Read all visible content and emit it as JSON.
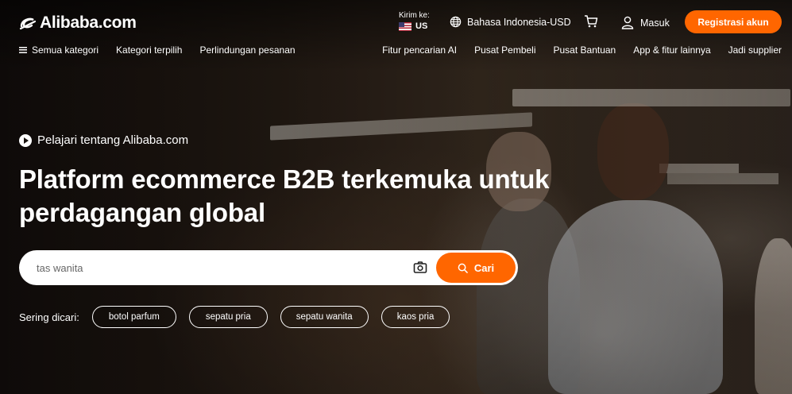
{
  "header": {
    "logo_text": "Alibaba.com",
    "ship_to_label": "Kirim ke:",
    "ship_to_country": "US",
    "language_currency": "Bahasa Indonesia-USD",
    "sign_in": "Masuk",
    "register": "Registrasi akun"
  },
  "nav": {
    "left": [
      {
        "label": "Semua kategori",
        "icon": "menu-icon"
      },
      {
        "label": "Kategori terpilih"
      },
      {
        "label": "Perlindungan pesanan"
      }
    ],
    "right": [
      {
        "label": "Fitur pencarian AI"
      },
      {
        "label": "Pusat Pembeli"
      },
      {
        "label": "Pusat Bantuan"
      },
      {
        "label": "App & fitur lainnya"
      },
      {
        "label": "Jadi supplier"
      }
    ]
  },
  "hero": {
    "learn_link": "Pelajari tentang Alibaba.com",
    "headline_line1": "Platform ecommerce B2B terkemuka untuk",
    "headline_line2": "perdagangan global"
  },
  "search": {
    "placeholder": "tas wanita",
    "button": "Cari"
  },
  "popular": {
    "label": "Sering dicari:",
    "chips": [
      "botol parfum",
      "sepatu pria",
      "sepatu wanita",
      "kaos pria"
    ]
  },
  "colors": {
    "accent": "#ff6600",
    "text": "#ffffff"
  }
}
